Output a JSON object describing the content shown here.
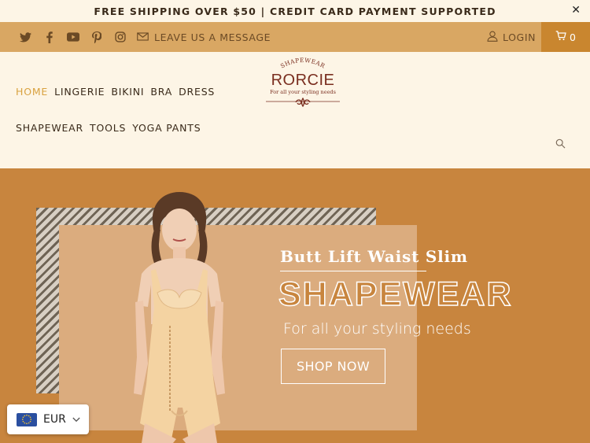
{
  "announcement": {
    "text": "FREE SHIPPING OVER $50 | CREDIT CARD PAYMENT SUPPORTED",
    "close": "✕"
  },
  "topbar": {
    "social_icons": [
      "twitter-icon",
      "facebook-icon",
      "youtube-icon",
      "pinterest-icon",
      "instagram-icon"
    ],
    "message_label": "LEAVE US A MESSAGE",
    "login_label": "LOGIN",
    "cart_count": "0"
  },
  "logo": {
    "top": "SHAPEWEAR",
    "main": "RORCIE",
    "sub": "For all your styling needs"
  },
  "nav": {
    "row1": [
      "HOME",
      "LINGERIE",
      "BIKINI",
      "BRA",
      "DRESS"
    ],
    "row2": [
      "SHAPEWEAR",
      "TOOLS",
      "YOGA PANTS"
    ],
    "active": "HOME"
  },
  "hero": {
    "line1": "Butt Lift Waist Slim",
    "line2": "SHAPEWEAR",
    "line3": "For all your styling needs",
    "button": "SHOP NOW"
  },
  "currency": {
    "code": "EUR"
  },
  "colors": {
    "accent": "#d9a763",
    "cart": "#c9862f",
    "hero_bg": "#c8853e",
    "cream": "#fdf5e6",
    "brand": "#7a2e1f"
  }
}
